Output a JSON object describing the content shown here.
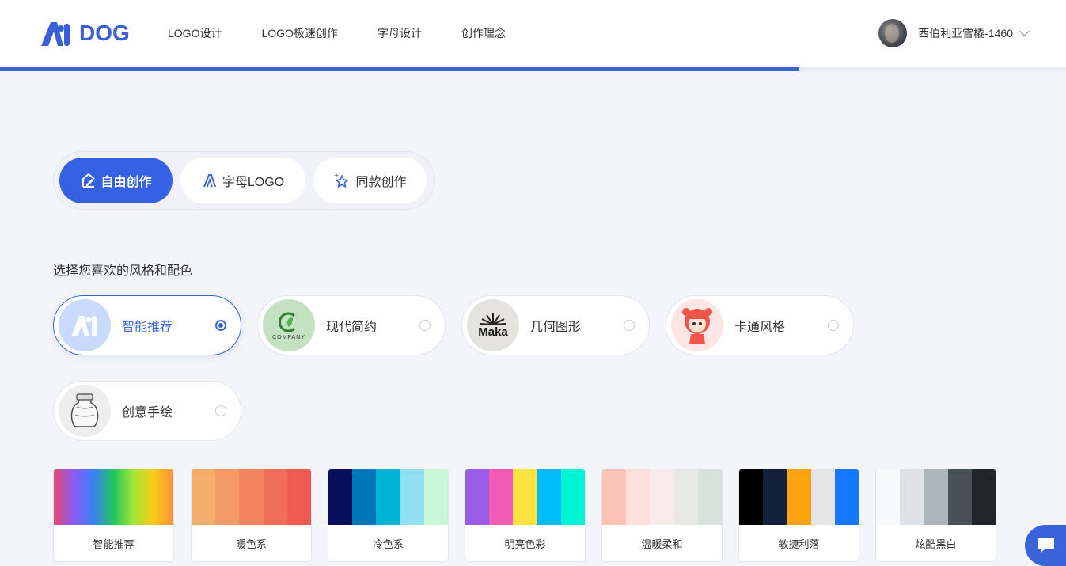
{
  "header": {
    "logo_text": "DOG",
    "nav": [
      "LOGO设计",
      "LOGO极速创作",
      "字母设计",
      "创作理念"
    ],
    "user_name": "西伯利亚雪橇-1460"
  },
  "progress": {
    "fraction": 0.75
  },
  "mode_tabs": [
    {
      "label": "自由创作",
      "active": true
    },
    {
      "label": "字母LOGO",
      "active": false
    },
    {
      "label": "同款创作",
      "active": false
    }
  ],
  "section_title": "选择您喜欢的风格和配色",
  "styles": [
    {
      "label": "智能推荐",
      "selected": true
    },
    {
      "label": "现代简约",
      "selected": false,
      "thumb_text": "COMPANY"
    },
    {
      "label": "几何图形",
      "selected": false,
      "thumb_text": "Maka"
    },
    {
      "label": "卡通风格",
      "selected": false
    },
    {
      "label": "创意手绘",
      "selected": false
    }
  ],
  "palettes": [
    {
      "label": "智能推荐",
      "colors": [
        "#e8466e",
        "#8b5cf6",
        "#3b82f6",
        "#22c55e",
        "#a3e635",
        "#facc15",
        "#fb923c"
      ]
    },
    {
      "label": "暖色系",
      "colors": [
        "#f6ae6c",
        "#f59a66",
        "#f2845f",
        "#f16f58",
        "#f05a52"
      ]
    },
    {
      "label": "冷色系",
      "colors": [
        "#0a0f5c",
        "#0077b6",
        "#00b4d8",
        "#90e0ef",
        "#c7f7d4"
      ]
    },
    {
      "label": "明亮色彩",
      "colors": [
        "#9b5de5",
        "#f15bb5",
        "#fee440",
        "#00bbf9",
        "#00f5d4"
      ]
    },
    {
      "label": "温暖柔和",
      "colors": [
        "#fbc4b6",
        "#fbe0dc",
        "#f8ecea",
        "#e8e8e4",
        "#d8e2dc"
      ]
    },
    {
      "label": "敏捷利落",
      "colors": [
        "#000000",
        "#14213d",
        "#fca311",
        "#e5e5e5",
        "#1677ff"
      ]
    },
    {
      "label": "炫酷黑白",
      "colors": [
        "#f8f9fa",
        "#dee2e6",
        "#adb5bd",
        "#495057",
        "#212529"
      ]
    }
  ],
  "colors": {
    "accent": "#3a62d9",
    "background": "#f4f5fa"
  }
}
